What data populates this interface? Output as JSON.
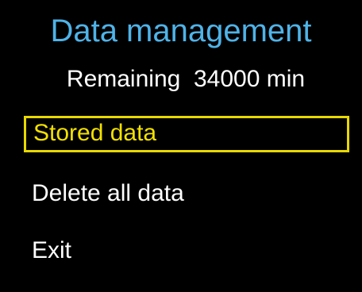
{
  "screen": {
    "title": "Data management",
    "remaining_text": "Remaining  34000 min"
  },
  "menu": {
    "items": [
      {
        "label": "Stored data",
        "selected": true
      },
      {
        "label": "Delete all data",
        "selected": false
      },
      {
        "label": "Exit",
        "selected": false
      }
    ]
  },
  "colors": {
    "background": "#000000",
    "title": "#4fb3e8",
    "text": "#ffffff",
    "highlight": "#e8d800"
  }
}
